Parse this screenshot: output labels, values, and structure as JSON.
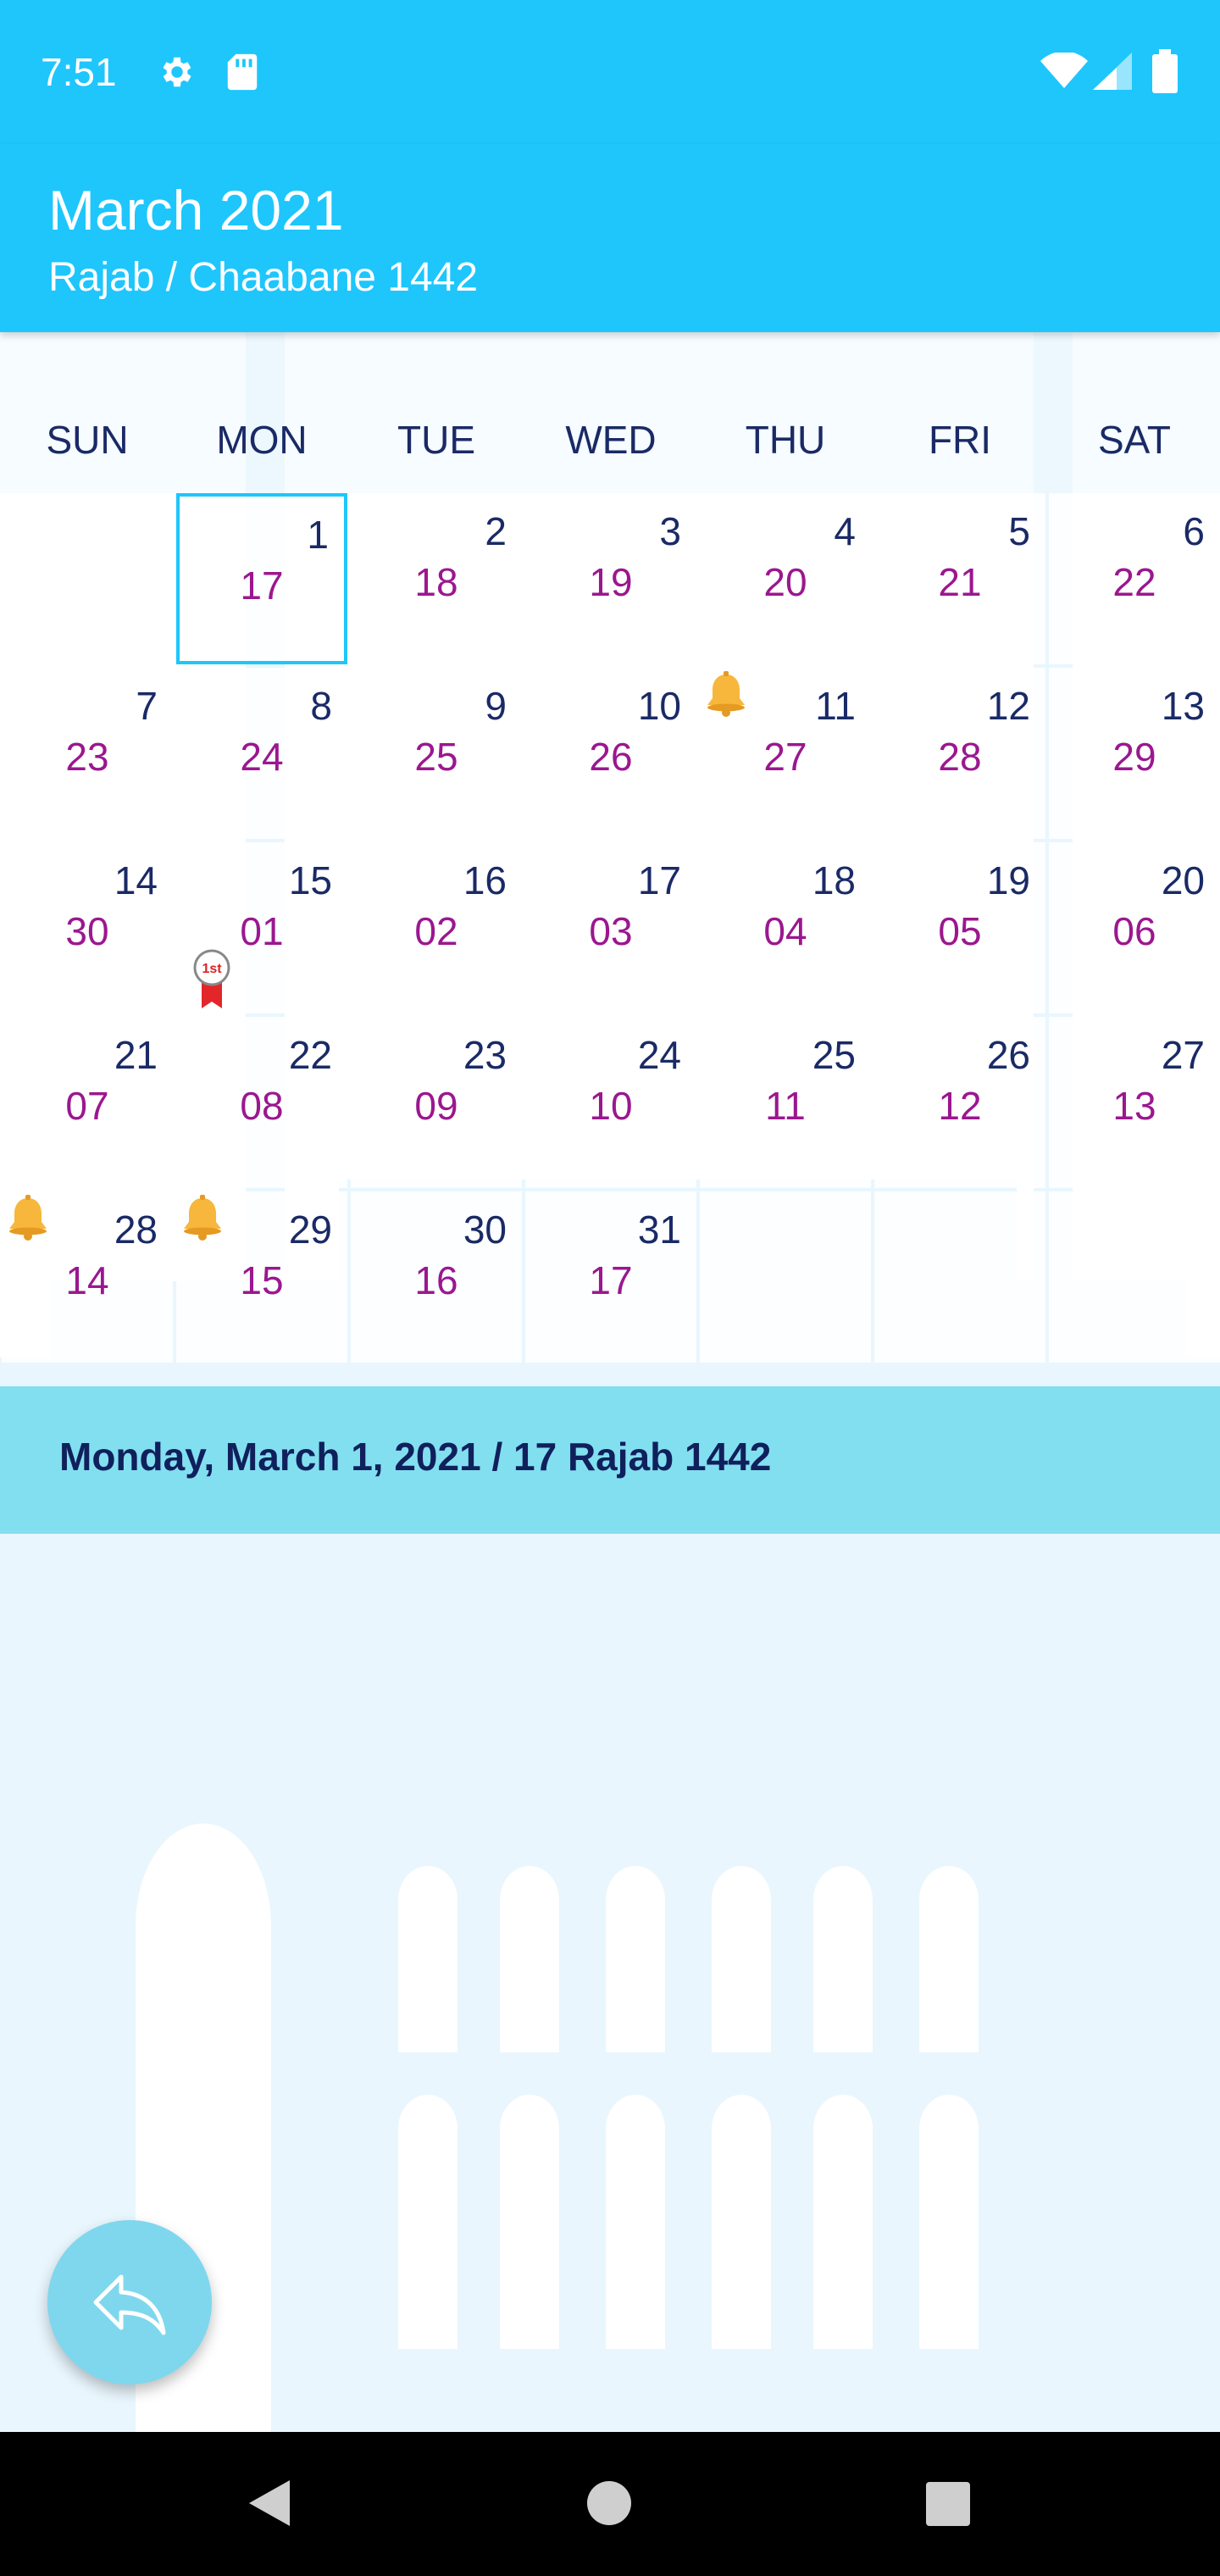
{
  "status": {
    "time": "7:51",
    "icons": [
      "gear-icon",
      "sd-card-icon",
      "wifi-icon",
      "signal-icon",
      "battery-icon"
    ]
  },
  "header": {
    "title": "March 2021",
    "subtitle": "Rajab / Chaabane 1442"
  },
  "weekdays": [
    "SUN",
    "MON",
    "TUE",
    "WED",
    "THU",
    "FRI",
    "SAT"
  ],
  "calendar": {
    "rows": [
      [
        {
          "greg": "",
          "hijri": ""
        },
        {
          "greg": "1",
          "hijri": "17",
          "selected": true
        },
        {
          "greg": "2",
          "hijri": "18"
        },
        {
          "greg": "3",
          "hijri": "19"
        },
        {
          "greg": "4",
          "hijri": "20"
        },
        {
          "greg": "5",
          "hijri": "21"
        },
        {
          "greg": "6",
          "hijri": "22"
        }
      ],
      [
        {
          "greg": "7",
          "hijri": "23"
        },
        {
          "greg": "8",
          "hijri": "24"
        },
        {
          "greg": "9",
          "hijri": "25"
        },
        {
          "greg": "10",
          "hijri": "26"
        },
        {
          "greg": "11",
          "hijri": "27",
          "icon": "bell-icon"
        },
        {
          "greg": "12",
          "hijri": "28"
        },
        {
          "greg": "13",
          "hijri": "29"
        }
      ],
      [
        {
          "greg": "14",
          "hijri": "30"
        },
        {
          "greg": "15",
          "hijri": "01",
          "icon": "first-day-medal-icon"
        },
        {
          "greg": "16",
          "hijri": "02"
        },
        {
          "greg": "17",
          "hijri": "03"
        },
        {
          "greg": "18",
          "hijri": "04"
        },
        {
          "greg": "19",
          "hijri": "05"
        },
        {
          "greg": "20",
          "hijri": "06"
        }
      ],
      [
        {
          "greg": "21",
          "hijri": "07"
        },
        {
          "greg": "22",
          "hijri": "08"
        },
        {
          "greg": "23",
          "hijri": "09"
        },
        {
          "greg": "24",
          "hijri": "10"
        },
        {
          "greg": "25",
          "hijri": "11"
        },
        {
          "greg": "26",
          "hijri": "12"
        },
        {
          "greg": "27",
          "hijri": "13"
        }
      ],
      [
        {
          "greg": "28",
          "hijri": "14",
          "icon": "bell-icon"
        },
        {
          "greg": "29",
          "hijri": "15",
          "icon": "bell-icon"
        },
        {
          "greg": "30",
          "hijri": "16"
        },
        {
          "greg": "31",
          "hijri": "17"
        },
        {
          "greg": "",
          "hijri": ""
        },
        {
          "greg": "",
          "hijri": ""
        },
        {
          "greg": "",
          "hijri": ""
        }
      ]
    ]
  },
  "selected_date": {
    "text": "Monday, March 1, 2021 / 17 Rajab 1442"
  },
  "fab": {
    "icon": "reply-icon"
  },
  "nav": {
    "icons": [
      "back-icon",
      "home-icon",
      "recents-icon"
    ]
  },
  "colors": {
    "accent": "#1ec6fc",
    "gregorian_text": "#1a2a66",
    "hijri_text": "#9b178f",
    "banner_bg": "#82dfef",
    "banner_text": "#10205c",
    "fab_bg": "#7fd7ee"
  }
}
